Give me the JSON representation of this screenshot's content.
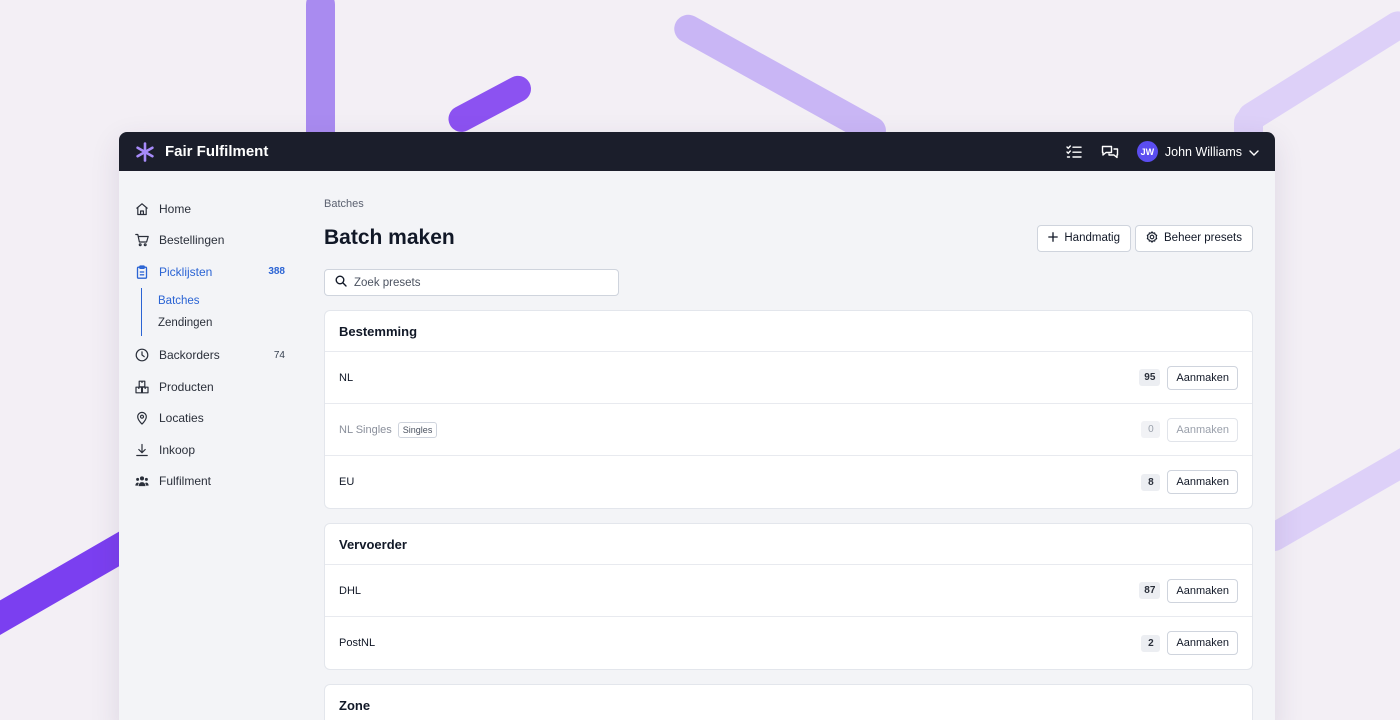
{
  "colors": {
    "background": "#f3eff5",
    "topbar": "#1b1e2b",
    "accent": "#2b64d4",
    "brand_purple": "#8b5cf6",
    "avatar": "#5b4df0"
  },
  "app": {
    "title": "Fair Fulfilment",
    "logo_icon": "asterisk-logo-icon"
  },
  "topbar": {
    "icons": [
      "checklist-icon",
      "chat-bubbles-icon"
    ],
    "user_initials": "JW",
    "user_name": "John Williams"
  },
  "sidebar": {
    "items": [
      {
        "label": "Home",
        "icon": "home-icon",
        "count": ""
      },
      {
        "label": "Bestellingen",
        "icon": "cart-icon",
        "count": ""
      },
      {
        "label": "Picklijsten",
        "icon": "clipboard-icon",
        "count": "388",
        "active": true
      },
      {
        "label": "Backorders",
        "icon": "clock-icon",
        "count": "74"
      },
      {
        "label": "Producten",
        "icon": "boxes-icon",
        "count": ""
      },
      {
        "label": "Locaties",
        "icon": "map-pin-icon",
        "count": ""
      },
      {
        "label": "Inkoop",
        "icon": "download-icon",
        "count": ""
      },
      {
        "label": "Fulfilment",
        "icon": "users-icon",
        "count": ""
      }
    ],
    "subitems": [
      {
        "label": "Batches",
        "active": true
      },
      {
        "label": "Zendingen"
      }
    ]
  },
  "main": {
    "breadcrumb": "Batches",
    "title": "Batch maken",
    "manual_button": "Handmatig",
    "presets_button": "Beheer presets",
    "search_placeholder": "Zoek presets",
    "create_label": "Aanmaken",
    "cards": [
      {
        "title": "Bestemming",
        "rows": [
          {
            "label": "NL",
            "count": "95"
          },
          {
            "label": "NL Singles",
            "tag": "Singles",
            "count": "0",
            "disabled": true
          },
          {
            "label": "EU",
            "count": "8"
          }
        ]
      },
      {
        "title": "Vervoerder",
        "rows": [
          {
            "label": "DHL",
            "count": "87"
          },
          {
            "label": "PostNL",
            "count": "2"
          }
        ]
      },
      {
        "title": "Zone",
        "rows": []
      }
    ]
  }
}
